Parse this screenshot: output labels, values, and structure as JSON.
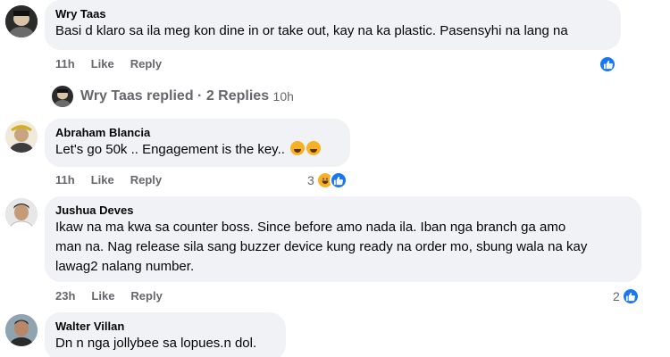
{
  "comments": [
    {
      "author": "Wry Taas",
      "text": "Basi d klaro sa ila meg kon dine in or take out, kay na ka plastic. Pasensyhi na lang na",
      "time": "11h",
      "like_label": "Like",
      "reply_label": "Reply",
      "reaction_count": ""
    },
    {
      "author": "Abraham Blancia",
      "text": "Let's go 50k .. Engagement is the key..",
      "time": "11h",
      "like_label": "Like",
      "reply_label": "Reply",
      "reaction_count": "3"
    },
    {
      "author": "Jushua Deves",
      "text_lines": [
        "Ikaw na ma kwa sa counter boss. Since before amo nada ila. Iban nga branch ga amo",
        "man na. Nag release sila sang buzzer device kung ready na order mo, sbung wala na kay",
        "lawag2 nalang number."
      ],
      "time": "23h",
      "like_label": "Like",
      "reply_label": "Reply",
      "reaction_count": "2"
    },
    {
      "author": "Walter Villan",
      "text": "Dn n nga jollybee sa lopues.n dol."
    }
  ],
  "replies_row": {
    "author": "Wry Taas",
    "verb": "replied",
    "separator": "·",
    "count_label": "2 Replies",
    "time": "10h"
  },
  "icons": {
    "like_reaction": "like-icon",
    "haha_reaction": "haha-icon"
  },
  "colors": {
    "bubble": "#f0f2f5",
    "like_blue": "#1877f2",
    "haha_yellow": "#f7b125",
    "secondary_text": "#65676b"
  }
}
